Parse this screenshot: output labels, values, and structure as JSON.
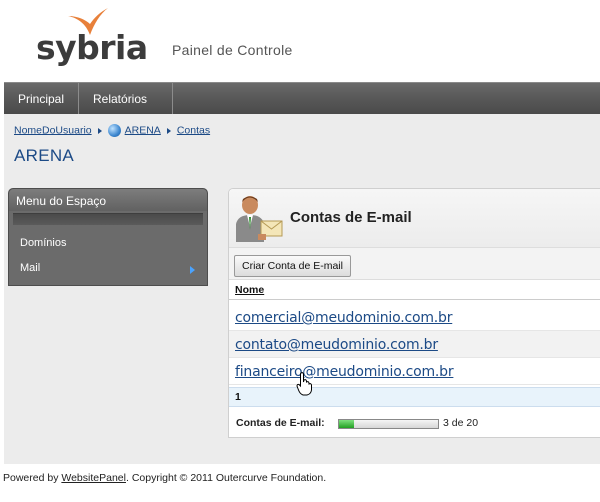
{
  "brand": {
    "logo_text": "sybria",
    "panel_title": "Painel de Controle",
    "accent": "#e8803a"
  },
  "nav": {
    "items": [
      {
        "label": "Principal"
      },
      {
        "label": "Relatórios"
      }
    ]
  },
  "breadcrumb": {
    "items": [
      "NomeDoUsuario",
      "ARENA",
      "Contas"
    ]
  },
  "space": {
    "title": "ARENA"
  },
  "menu": {
    "title": "Menu do Espaço",
    "items": [
      {
        "label": "Domínios"
      },
      {
        "label": "Mail"
      }
    ]
  },
  "panel": {
    "title": "Contas de E-mail",
    "create_button": "Criar Conta de E-mail",
    "column_name": "Nome",
    "rows": [
      "comercial@meudominio.com.br",
      "contato@meudominio.com.br",
      "financeiro@meudominio.com.br"
    ],
    "pager": "1",
    "quota": {
      "label": "Contas de E-mail:",
      "text": "3 de 20",
      "fraction": 0.15
    }
  },
  "footer": {
    "prefix": "Powered by ",
    "link": "WebsitePanel",
    "suffix": ". Copyright © 2011 Outercurve Foundation."
  }
}
